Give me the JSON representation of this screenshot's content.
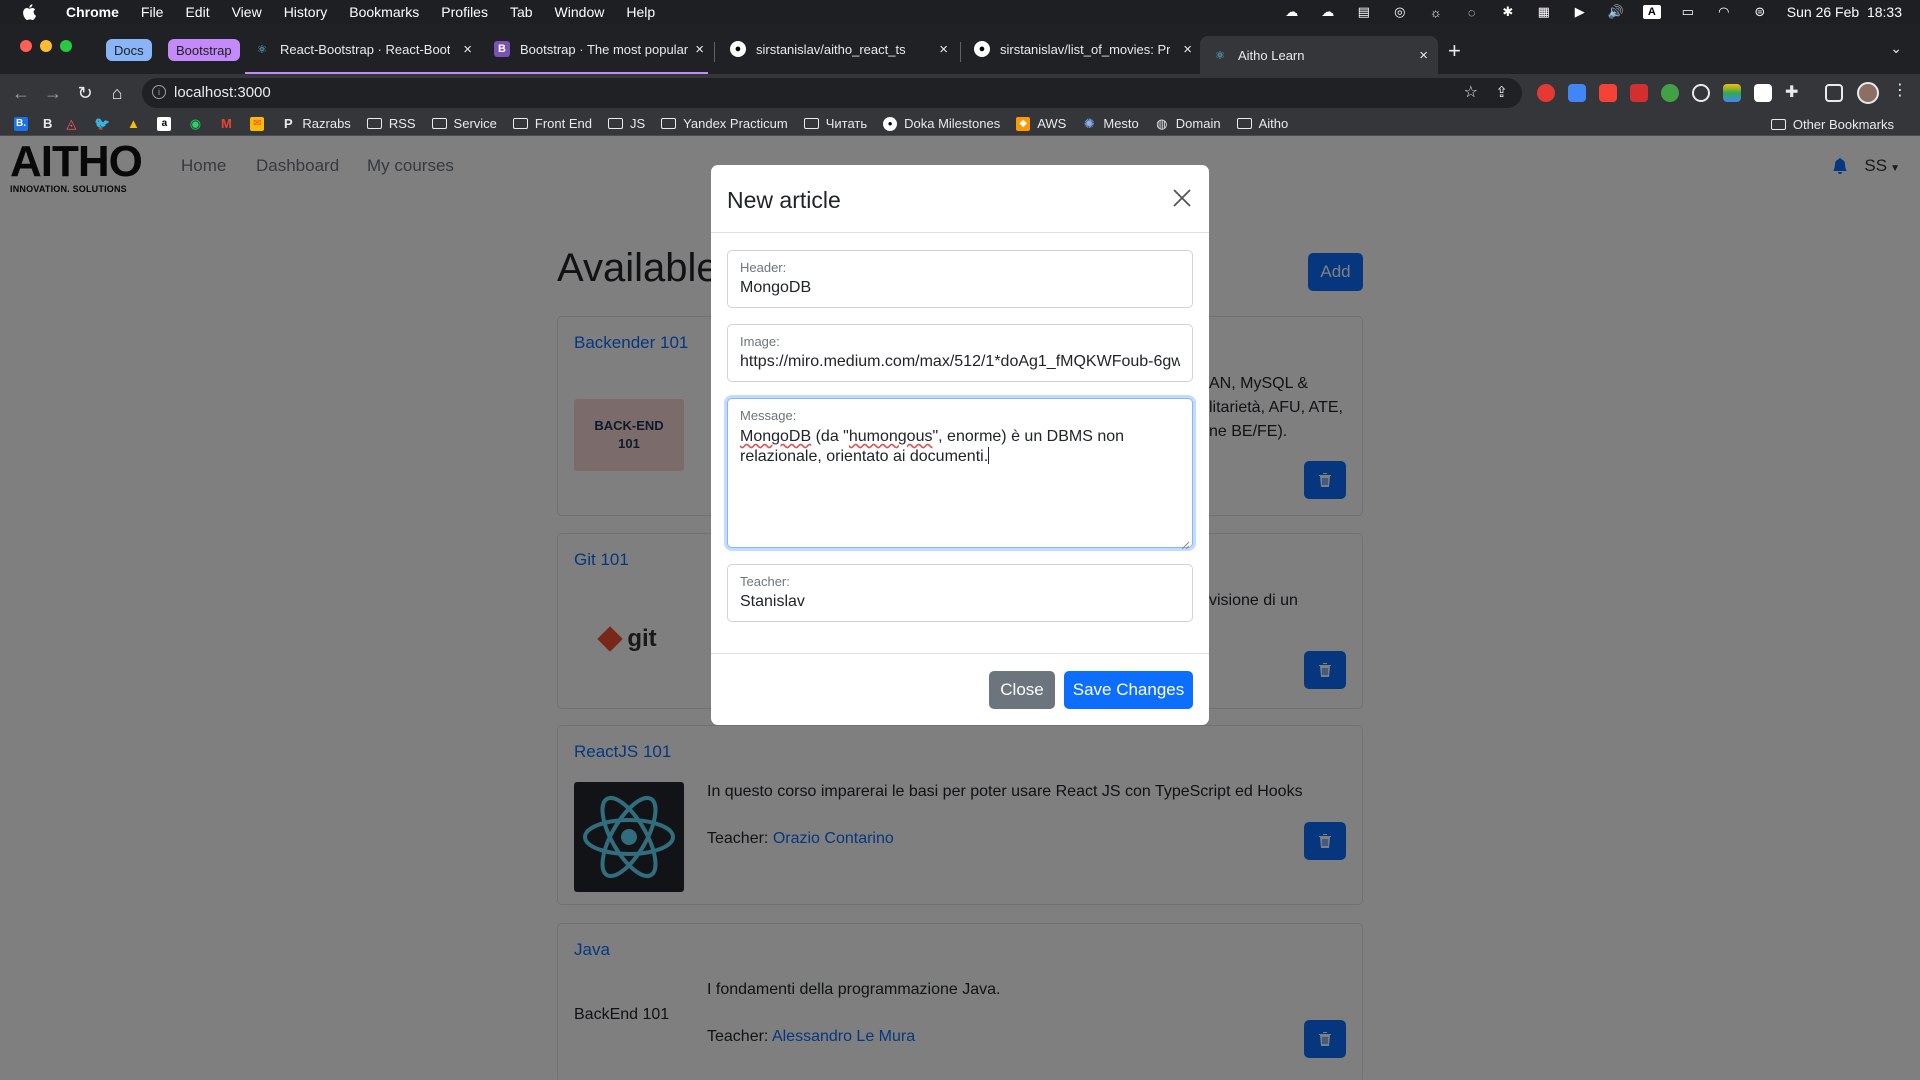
{
  "menubar": {
    "app": "Chrome",
    "items": [
      "File",
      "Edit",
      "View",
      "History",
      "Bookmarks",
      "Profiles",
      "Tab",
      "Window",
      "Help"
    ],
    "datetime": "Sun 26 Feb  18:33"
  },
  "tab_groups": [
    {
      "label": "Docs",
      "color": "#8ab4f8"
    },
    {
      "label": "Bootstrap",
      "color": "#c58af9"
    }
  ],
  "tabs": [
    {
      "title": "React-Bootstrap · React-Boots",
      "icon": "react-bootstrap-icon"
    },
    {
      "title": "Bootstrap · The most popular H",
      "icon": "bootstrap-icon"
    },
    {
      "title": "sirstanislav/aitho_react_ts",
      "icon": "github-icon"
    },
    {
      "title": "sirstanislav/list_of_movies: Pr",
      "icon": "github-icon"
    },
    {
      "title": "Aitho Learn",
      "icon": "react-icon",
      "active": true
    }
  ],
  "address_bar": {
    "url": "localhost:3000"
  },
  "bookmarks": [
    {
      "label": "B",
      "type": "icon"
    },
    {
      "label": "Razrabs",
      "type": "icon"
    },
    {
      "label": "RSS",
      "type": "folder"
    },
    {
      "label": "Service",
      "type": "folder"
    },
    {
      "label": "Front End",
      "type": "folder"
    },
    {
      "label": "JS",
      "type": "folder"
    },
    {
      "label": "Yandex Practicum",
      "type": "folder"
    },
    {
      "label": "Читать",
      "type": "folder"
    },
    {
      "label": "Doka Milestones",
      "type": "github"
    },
    {
      "label": "AWS",
      "type": "icon"
    },
    {
      "label": "Mesto",
      "type": "icon"
    },
    {
      "label": "Domain",
      "type": "icon"
    },
    {
      "label": "Aitho",
      "type": "folder"
    }
  ],
  "other_bookmarks": "Other Bookmarks",
  "site": {
    "logo_main": "AITHO",
    "logo_sub": "INNOVATION. SOLUTIONS",
    "nav": [
      "Home",
      "Dashboard",
      "My courses"
    ],
    "user_initials": "SS",
    "heading": "Available",
    "add_label": "Add"
  },
  "courses": [
    {
      "title": "Backender 101",
      "desc_visible": "AN, MySQL &",
      "desc_visible2": "litarietà, AFU, ATE,",
      "desc_visible3": "ne BE/FE).",
      "thumb_text": "BACK-END 101"
    },
    {
      "title": "Git 101",
      "desc_visible": "visione di un",
      "thumb_text": "git"
    },
    {
      "title": "ReactJS 101",
      "desc": "In questo corso imparerai le basi per poter usare React JS con TypeScript ed Hooks",
      "teacher_label": "Teacher:",
      "teacher": "Orazio Contarino"
    },
    {
      "title": "Java",
      "desc": "I fondamenti della programmazione Java.",
      "teacher_label": "Teacher:",
      "teacher": "Alessandro Le Mura",
      "thumb_alt": "BackEnd 101"
    }
  ],
  "modal": {
    "title": "New article",
    "header_label": "Header:",
    "header_value": "MongoDB",
    "image_label": "Image:",
    "image_value": "https://miro.medium.com/max/512/1*doAg1_fMQKWFoub-6gw",
    "message_label": "Message:",
    "message_value_part1": "MongoDB",
    "message_value_part2": " (da \"",
    "message_value_part3": "humongous",
    "message_value_part4": "\", enorme) è un DBMS non relazionale, orientato ai documenti.",
    "teacher_label": "Teacher:",
    "teacher_value": "Stanislav",
    "close_label": "Close",
    "save_label": "Save Changes"
  },
  "colors": {
    "primary": "#0d6efd",
    "secondary": "#6c757d"
  }
}
